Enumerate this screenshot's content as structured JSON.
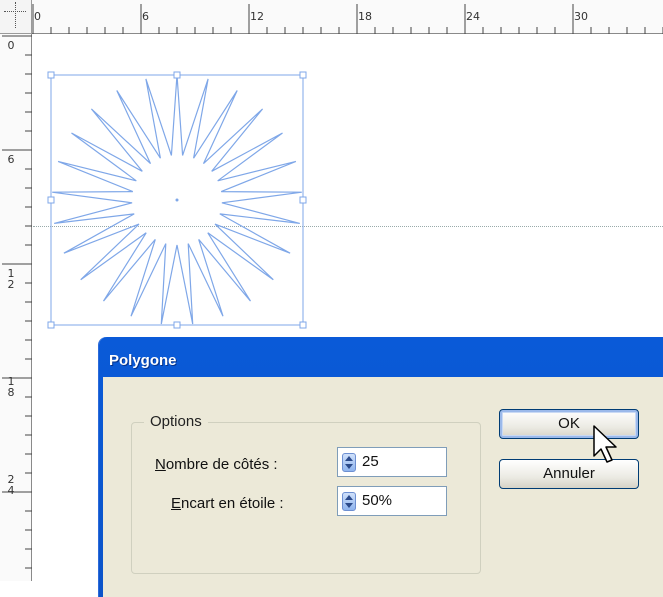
{
  "ruler": {
    "top_labels": [
      "0",
      "6",
      "12",
      "18",
      "24",
      "30"
    ],
    "left_labels": [
      "0",
      "6",
      "1\n2",
      "1\n8",
      "2\n4"
    ]
  },
  "canvas": {
    "shape": "star",
    "points": 25,
    "inset_percent": 50,
    "stroke_color": "#7fa7e8",
    "selection_color": "#7fa7e8"
  },
  "dialog": {
    "title": "Polygone",
    "group_label": "Options",
    "sides_label_mnemonic": "N",
    "sides_label_rest": "ombre de côtés :",
    "sides_value": "25",
    "inset_label_mnemonic": "E",
    "inset_label_rest": "ncart en étoile :",
    "inset_value": "50%",
    "ok_label": "OK",
    "cancel_label": "Annuler",
    "titlebar_color": "#0b57d0",
    "body_color": "#ece9d8"
  },
  "icons": {
    "cursor": "arrow-cursor-icon",
    "spinner": "spinner-arrows-icon"
  }
}
